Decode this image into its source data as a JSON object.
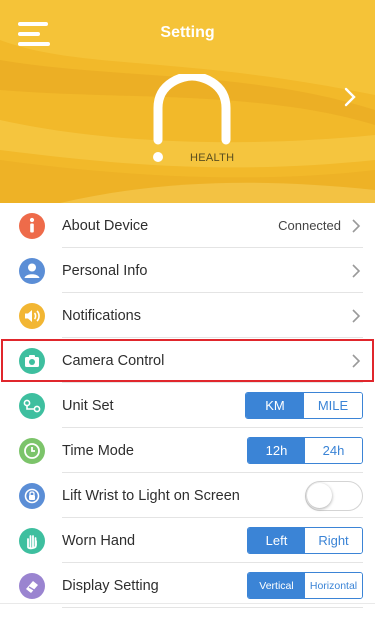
{
  "header": {
    "title": "Setting",
    "device_label": "HEALTH"
  },
  "colors": {
    "header_bg": "#f2b92a",
    "accent_blue": "#3b84d6",
    "highlight_red": "#e0262c"
  },
  "rows": [
    {
      "label": "About Device",
      "value": "Connected",
      "icon": "info-icon",
      "color": "#ee6b4a"
    },
    {
      "label": "Personal Info",
      "icon": "person-icon",
      "color": "#5b8ed6"
    },
    {
      "label": "Notifications",
      "icon": "speaker-icon",
      "color": "#f2b633"
    },
    {
      "label": "Camera Control",
      "icon": "camera-icon",
      "color": "#3ebf9f"
    },
    {
      "label": "Unit Set",
      "icon": "route-icon",
      "color": "#3ebf9f",
      "options": [
        "KM",
        "MILE"
      ],
      "selected": "KM"
    },
    {
      "label": "Time Mode",
      "icon": "clock-icon",
      "color": "#7cc46a",
      "options": [
        "12h",
        "24h"
      ],
      "selected": "12h"
    },
    {
      "label": "Lift Wrist to Light on Screen",
      "icon": "wrist-icon",
      "color": "#5b8ed6",
      "toggle": false
    },
    {
      "label": "Worn Hand",
      "icon": "hand-icon",
      "color": "#3ebf9f",
      "options": [
        "Left",
        "Right"
      ],
      "selected": "Left"
    },
    {
      "label": "Display Setting",
      "icon": "display-icon",
      "color": "#9a84d0",
      "options": [
        "Vertical",
        "Horizontal"
      ],
      "selected": "Vertical"
    }
  ]
}
